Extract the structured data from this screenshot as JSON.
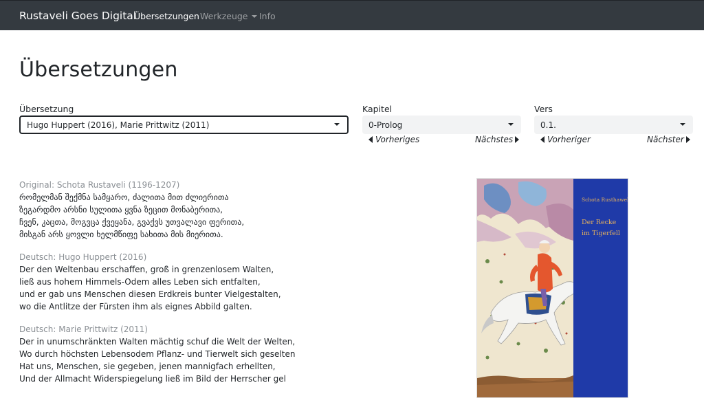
{
  "navbar": {
    "brand": "Rustaveli Goes Digital",
    "links": [
      {
        "label": "Übersetzungen",
        "active": true
      },
      {
        "label": "Werkzeuge",
        "dropdown": true
      },
      {
        "label": "Info"
      }
    ]
  },
  "page": {
    "title": "Übersetzungen"
  },
  "form": {
    "translation": {
      "label": "Übersetzung",
      "value": "Hugo Huppert (2016), Marie Prittwitz (2011)"
    },
    "chapter": {
      "label": "Kapitel",
      "value": "0-Prolog",
      "prev": "Vorheriges",
      "next": "Nächstes"
    },
    "verse": {
      "label": "Vers",
      "value": "0.1.",
      "prev": "Vorheriger",
      "next": "Nächster"
    }
  },
  "texts": [
    {
      "label": "Original: Schota Rustaveli (1196-1207)",
      "lines": [
        "რომელმან შექმნა სამყარო, ძალითა მით ძლიერითა",
        "ზეგარდმო არსნი სულითა ყვნა ზეცით მონაბერითა,",
        "ჩვენ, კაცთა, მოგვცა ქვეყანა, გვაქვს უთვალავი ფერითა,",
        "მისგან არს ყოვლი ხელმწიფე სახითა მის მიერითა."
      ]
    },
    {
      "label": "Deutsch: Hugo Huppert (2016)",
      "lines": [
        "Der den Weltenbau erschaffen, groß in grenzenlosem Walten,",
        "ließ aus hohem Himmels-Odem alles Leben sich entfalten,",
        "und er gab uns Menschen diesen Erdkreis bunter Vielgestalten,",
        "wo die Antlitze der Fürsten ihm als eignes Abbild galten."
      ]
    },
    {
      "label": "Deutsch: Marie Prittwitz (2011)",
      "lines": [
        "Der in unumschränkten Walten mächtig schuf die Welt der Welten,",
        "Wo durch höchsten Lebensodem Pflanz- und Tierwelt sich geselten",
        "Hat uns, Menschen, sie gegeben, jenen mannigfach erhellten,",
        "Und der Allmacht Widerspiegelung ließ im Bild der Herrscher gel"
      ]
    }
  ],
  "cover": {
    "author": "Schota Rusthaweli",
    "title_line1": "Der Recke",
    "title_line2": "im Tigerfell"
  },
  "colors": {
    "navbar": "#343a40",
    "cover_blue": "#1f3aa8",
    "select_bg": "#f2f3f4",
    "muted_text": "#8a8f94"
  },
  "icons": {
    "dropdown": "caret-down-icon",
    "prev": "triangle-left-icon",
    "next": "triangle-right-icon"
  }
}
